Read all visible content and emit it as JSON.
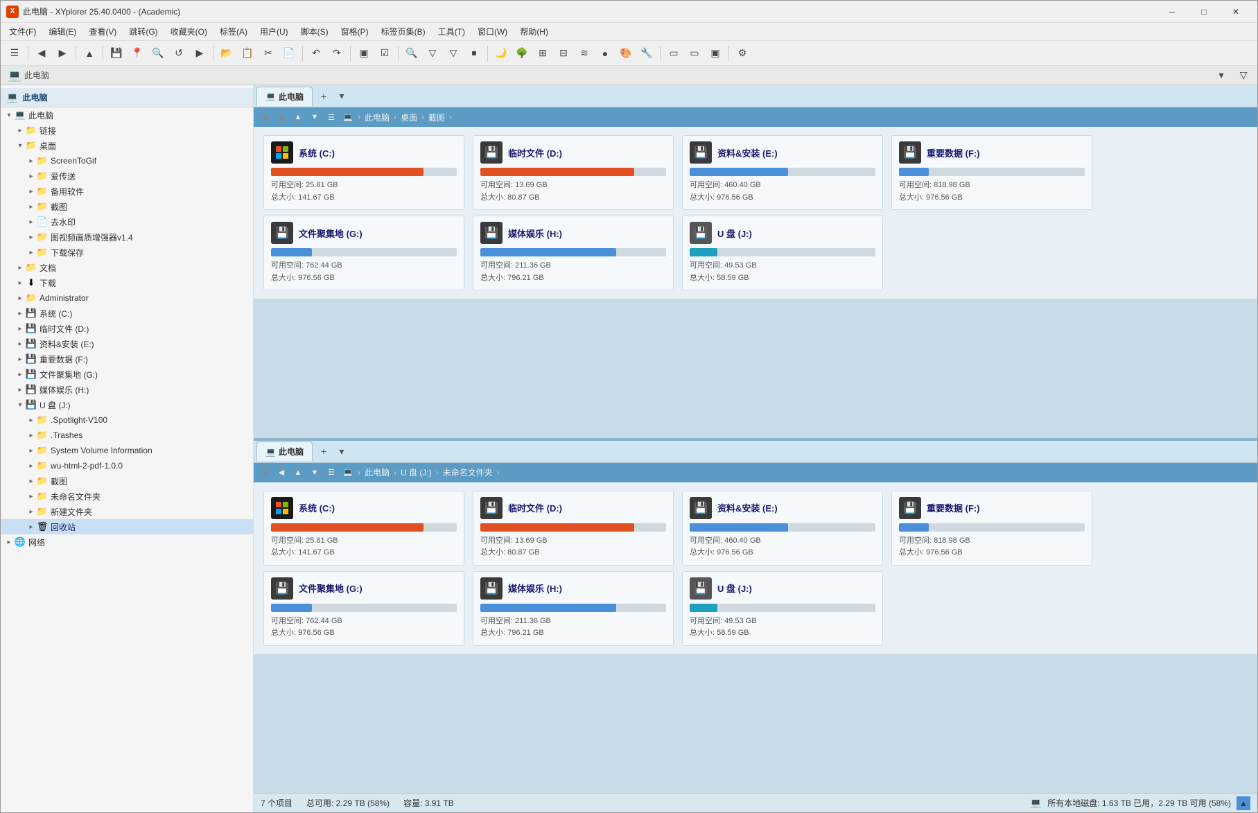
{
  "window": {
    "title": "此电脑 - XYplorer 25.40.0400 - (Academic)",
    "app_icon": "X"
  },
  "menu": {
    "items": [
      "文件(F)",
      "编辑(E)",
      "查看(V)",
      "跳转(G)",
      "收藏夹(O)",
      "标签(A)",
      "用户(U)",
      "脚本(S)",
      "窗格(P)",
      "标签页集(B)",
      "工具(T)",
      "窗口(W)",
      "帮助(H)"
    ]
  },
  "sidebar": {
    "header": "此电脑",
    "items": [
      {
        "label": "此电脑",
        "level": 0,
        "icon": "💻",
        "expanded": true,
        "selected": false
      },
      {
        "label": "链接",
        "level": 1,
        "icon": "📁",
        "expanded": false,
        "selected": false
      },
      {
        "label": "桌面",
        "level": 1,
        "icon": "📁",
        "expanded": true,
        "selected": false,
        "color_blue": true
      },
      {
        "label": "ScreenToGif",
        "level": 2,
        "icon": "📁",
        "expanded": false,
        "selected": false
      },
      {
        "label": "爱传送",
        "level": 2,
        "icon": "📁",
        "expanded": false,
        "selected": false
      },
      {
        "label": "备用软件",
        "level": 2,
        "icon": "📁",
        "expanded": false,
        "selected": false
      },
      {
        "label": "截图",
        "level": 2,
        "icon": "📁",
        "expanded": false,
        "selected": false,
        "color_blue": true
      },
      {
        "label": "去水印",
        "level": 2,
        "icon": "📄",
        "expanded": false,
        "selected": false
      },
      {
        "label": "图视频画质增强器v1.4",
        "level": 2,
        "icon": "📁",
        "expanded": false,
        "selected": false
      },
      {
        "label": "下载保存",
        "level": 2,
        "icon": "📁",
        "expanded": false,
        "selected": false
      },
      {
        "label": "文档",
        "level": 1,
        "icon": "📁",
        "expanded": false,
        "selected": false
      },
      {
        "label": "下载",
        "level": 1,
        "icon": "⬇",
        "expanded": false,
        "selected": false
      },
      {
        "label": "Administrator",
        "level": 1,
        "icon": "📁",
        "expanded": false,
        "selected": false
      },
      {
        "label": "系统 (C:)",
        "level": 1,
        "icon": "💾",
        "expanded": false,
        "selected": false
      },
      {
        "label": "临时文件 (D:)",
        "level": 1,
        "icon": "💾",
        "expanded": false,
        "selected": false
      },
      {
        "label": "资料&安装 (E:)",
        "level": 1,
        "icon": "💾",
        "expanded": false,
        "selected": false
      },
      {
        "label": "重要数据 (F:)",
        "level": 1,
        "icon": "💾",
        "expanded": false,
        "selected": false
      },
      {
        "label": "文件聚集地 (G:)",
        "level": 1,
        "icon": "💾",
        "expanded": false,
        "selected": false
      },
      {
        "label": "媒体娱乐 (H:)",
        "level": 1,
        "icon": "💾",
        "expanded": false,
        "selected": false
      },
      {
        "label": "U 盘 (J:)",
        "level": 1,
        "icon": "💾",
        "expanded": true,
        "selected": false
      },
      {
        "label": ".Spotlight-V100",
        "level": 2,
        "icon": "📁",
        "expanded": false,
        "selected": false
      },
      {
        "label": ".Trashes",
        "level": 2,
        "icon": "📁",
        "expanded": false,
        "selected": false
      },
      {
        "label": "System Volume Information",
        "level": 2,
        "icon": "📁",
        "expanded": false,
        "selected": false
      },
      {
        "label": "wu-html-2-pdf-1.0.0",
        "level": 2,
        "icon": "📁",
        "expanded": false,
        "selected": false
      },
      {
        "label": "截图",
        "level": 2,
        "icon": "📁",
        "expanded": false,
        "selected": false
      },
      {
        "label": "未命名文件夹",
        "level": 2,
        "icon": "📁",
        "expanded": false,
        "selected": false
      },
      {
        "label": "新建文件夹",
        "level": 2,
        "icon": "📁",
        "expanded": false,
        "selected": false
      },
      {
        "label": "回收站",
        "level": 2,
        "icon": "🗑",
        "expanded": false,
        "selected": true
      },
      {
        "label": "网络",
        "level": 0,
        "icon": "🌐",
        "expanded": false,
        "selected": false
      }
    ]
  },
  "panel_top": {
    "tab_label": "此电脑",
    "breadcrumb": [
      "此电脑",
      "桌面",
      "截图"
    ],
    "drives": [
      {
        "name": "系统 (C:)",
        "used_pct": 82,
        "free": "可用空间: 25.81 GB",
        "total": "总大小: 141.67 GB",
        "bar_color": "red"
      },
      {
        "name": "临时文件 (D:)",
        "used_pct": 83,
        "free": "可用空间: 13.69 GB",
        "total": "总大小: 80.87 GB",
        "bar_color": "red"
      },
      {
        "name": "资料&安装 (E:)",
        "used_pct": 53,
        "free": "可用空间: 460.40 GB",
        "total": "总大小: 976.56 GB",
        "bar_color": "blue"
      },
      {
        "name": "重要数据 (F:)",
        "used_pct": 16,
        "free": "可用空间: 818.98 GB",
        "total": "总大小: 976.56 GB",
        "bar_color": "blue"
      },
      {
        "name": "文件聚集地 (G:)",
        "used_pct": 22,
        "free": "可用空间: 762.44 GB",
        "total": "总大小: 976.56 GB",
        "bar_color": "blue"
      },
      {
        "name": "媒体娱乐 (H:)",
        "used_pct": 73,
        "free": "可用空间: 211.36 GB",
        "total": "总大小: 796.21 GB",
        "bar_color": "blue"
      },
      {
        "name": "U 盘 (J:)",
        "used_pct": 15,
        "free": "可用空间: 49.53 GB",
        "total": "总大小: 58.59 GB",
        "bar_color": "cyan"
      }
    ]
  },
  "panel_bottom": {
    "tab_label": "此电脑",
    "breadcrumb": [
      "此电脑",
      "U 盘 (J:)",
      "未命名文件夹"
    ],
    "drives": [
      {
        "name": "系统 (C:)",
        "used_pct": 82,
        "free": "可用空间: 25.81 GB",
        "total": "总大小: 141.67 GB",
        "bar_color": "red"
      },
      {
        "name": "临时文件 (D:)",
        "used_pct": 83,
        "free": "可用空间: 13.69 GB",
        "total": "总大小: 80.87 GB",
        "bar_color": "red"
      },
      {
        "name": "资料&安装 (E:)",
        "used_pct": 53,
        "free": "可用空间: 460.40 GB",
        "total": "总大小: 976.56 GB",
        "bar_color": "blue"
      },
      {
        "name": "重要数据 (F:)",
        "used_pct": 16,
        "free": "可用空间: 818.98 GB",
        "total": "总大小: 976.56 GB",
        "bar_color": "blue"
      },
      {
        "name": "文件聚集地 (G:)",
        "used_pct": 22,
        "free": "可用空间: 762.44 GB",
        "total": "总大小: 976.56 GB",
        "bar_color": "blue"
      },
      {
        "name": "媒体娱乐 (H:)",
        "used_pct": 73,
        "free": "可用空间: 211.36 GB",
        "total": "总大小: 796.21 GB",
        "bar_color": "blue"
      },
      {
        "name": "U 盘 (J:)",
        "used_pct": 15,
        "free": "可用空间: 49.53 GB",
        "total": "总大小: 58.59 GB",
        "bar_color": "cyan"
      }
    ]
  },
  "status_bar": {
    "item_count": "7 个项目",
    "total_free": "总可用: 2.29 TB (58%)",
    "capacity": "容量: 3.91 TB",
    "disk_summary": "所有本地磁盘: 1.63 TB 已用，2.29 TB 可用 (58%)"
  }
}
